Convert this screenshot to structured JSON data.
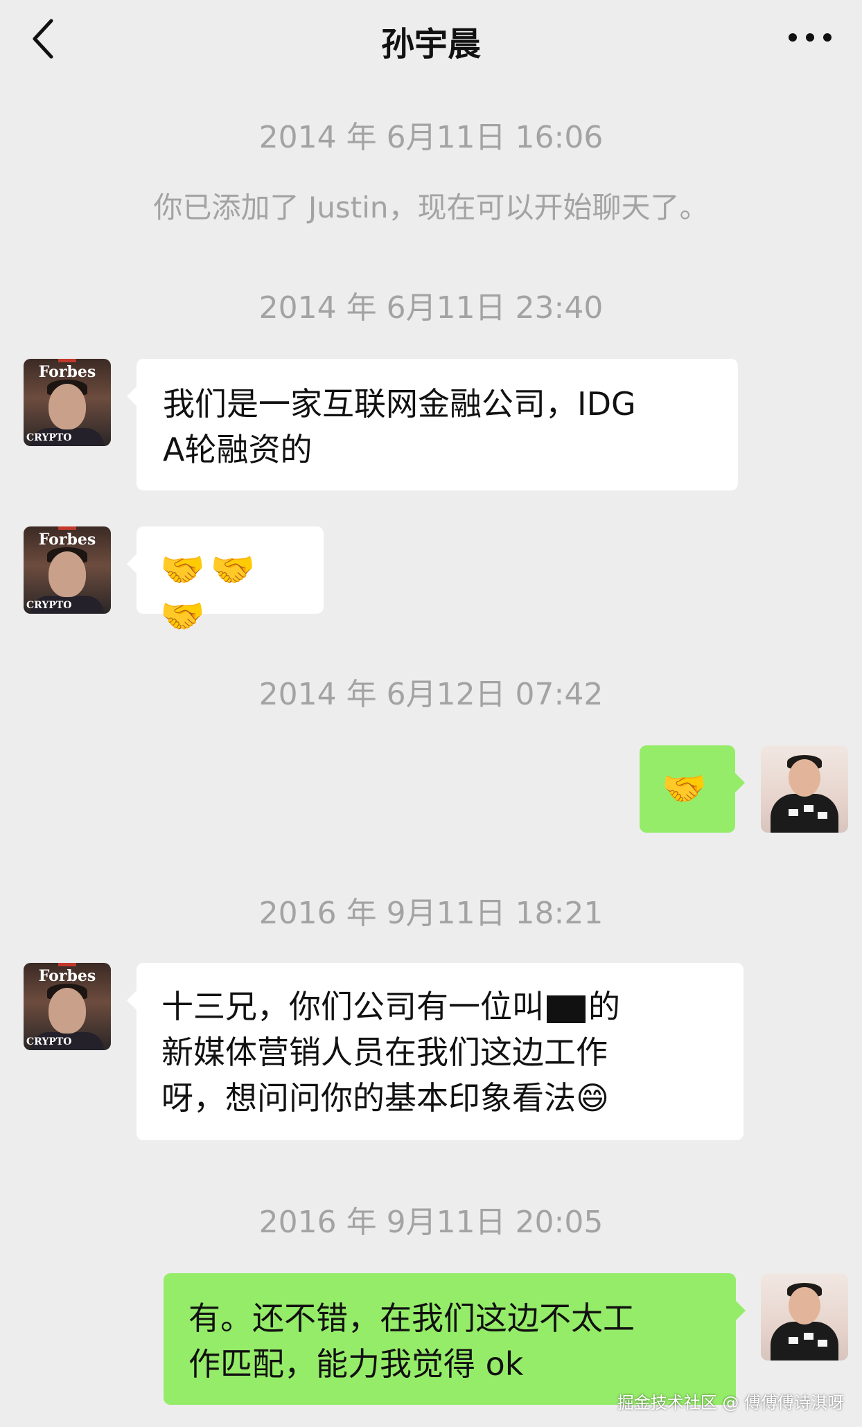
{
  "header": {
    "title": "孙宇晨",
    "back_icon": "chevron-left-icon",
    "more_icon": "ellipsis-icon"
  },
  "messages": {
    "ts1": "2014 年 6月11日 16:06",
    "system_notice": "你已添加了 Justin，现在可以开始聊天了。",
    "ts2": "2014 年 6月11日 23:40",
    "m1_line1": "我们是一家互联网金融公司，IDG",
    "m1_line2": "A轮融资的",
    "m2_emoji": "🤝🤝🤝",
    "ts3": "2014 年 6月12日 07:42",
    "m3_emoji": "🤝",
    "ts4": "2016 年 9月11日 18:21",
    "m4_line1_a": "十三兄，你们公司有一位叫",
    "m4_line1_b": "的",
    "m4_line2": "新媒体营销人员在我们这边工作",
    "m4_line3": "呀，想问问你的基本印象看法😄",
    "ts5": "2016 年 9月11日 20:05",
    "m5_line1": "有。还不错，在我们这边不太工",
    "m5_line2": "作匹配，能力我觉得 ok"
  },
  "contact_avatar": {
    "magazine": "Forbes",
    "cover_text": "CRYPTO"
  },
  "watermark": "掘金技术社区 @ 傅傅傅诗淇呀",
  "colors": {
    "background": "#ededed",
    "incoming_bubble": "#ffffff",
    "outgoing_bubble": "#95ec69",
    "timestamp": "#a3a3a3"
  }
}
